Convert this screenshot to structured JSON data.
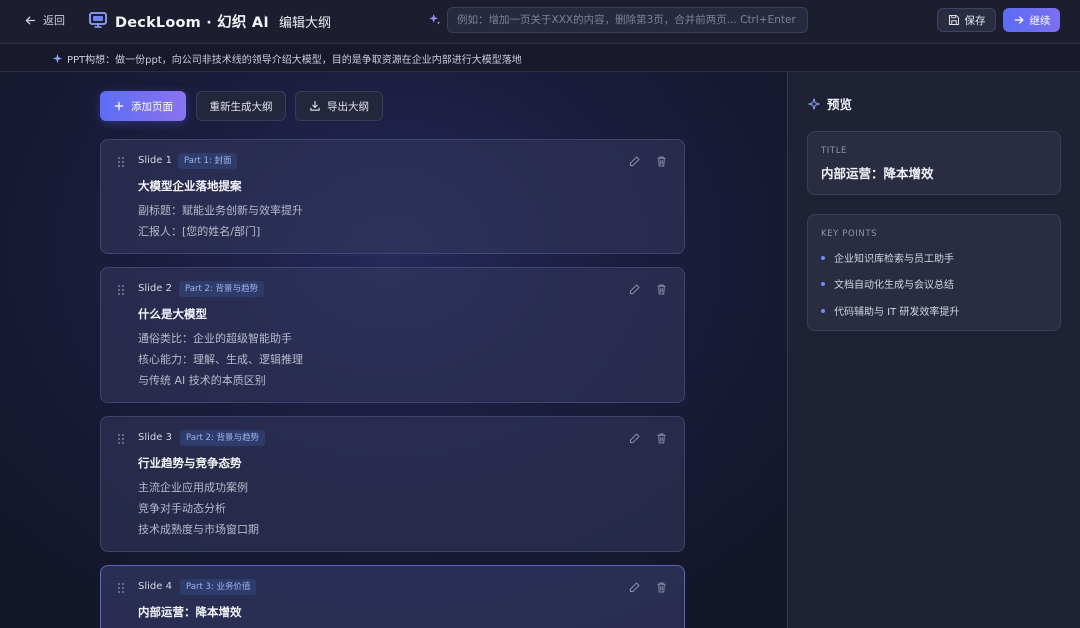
{
  "header": {
    "back_label": "返回",
    "brand": "DeckLoom · 幻织 AI",
    "page_title": "编辑大纲",
    "command_placeholder": "例如：增加一页关于XXX的内容，删除第3页，合并前两页... Ctrl+Enter",
    "save_label": "保存",
    "continue_label": "继续"
  },
  "concept": "PPT构想：做一份ppt，向公司非技术线的领导介绍大模型，目的是争取资源在企业内部进行大模型落地",
  "toolbar": {
    "add_label": "添加页面",
    "regen_label": "重新生成大纲",
    "export_label": "导出大纲"
  },
  "slides": [
    {
      "no": "Slide 1",
      "part": "Part 1: 封面",
      "title": "大模型企业落地提案",
      "bullets": [
        "副标题：赋能业务创新与效率提升",
        "汇报人：[您的姓名/部门]"
      ]
    },
    {
      "no": "Slide 2",
      "part": "Part 2: 背景与趋势",
      "title": "什么是大模型",
      "bullets": [
        "通俗类比：企业的超级智能助手",
        "核心能力：理解、生成、逻辑推理",
        "与传统 AI 技术的本质区别"
      ]
    },
    {
      "no": "Slide 3",
      "part": "Part 2: 背景与趋势",
      "title": "行业趋势与竞争态势",
      "bullets": [
        "主流企业应用成功案例",
        "竞争对手动态分析",
        "技术成熟度与市场窗口期"
      ]
    },
    {
      "no": "Slide 4",
      "part": "Part 3: 业务价值",
      "title": "内部运营：降本增效",
      "bullets": []
    }
  ],
  "preview": {
    "heading": "预览",
    "title_label": "TITLE",
    "title": "内部运营：降本增效",
    "key_points_label": "KEY POINTS",
    "key_points": [
      "企业知识库检索与员工助手",
      "文档自动化生成与会议总结",
      "代码辅助与 IT 研发效率提升"
    ]
  }
}
